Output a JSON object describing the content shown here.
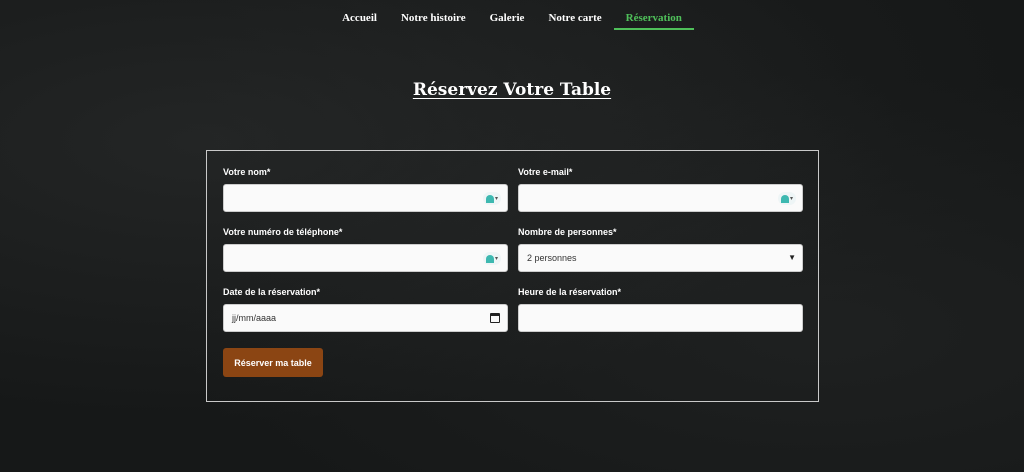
{
  "nav": {
    "items": [
      {
        "label": "Accueil"
      },
      {
        "label": "Notre histoire"
      },
      {
        "label": "Galerie"
      },
      {
        "label": "Notre carte"
      },
      {
        "label": "Réservation"
      }
    ],
    "active_index": 4,
    "active_color": "#4fc05a"
  },
  "page": {
    "title": "Réservez Votre Table"
  },
  "form": {
    "name": {
      "label": "Votre nom*",
      "value": ""
    },
    "email": {
      "label": "Votre e-mail*",
      "value": ""
    },
    "phone": {
      "label": "Votre numéro de téléphone*",
      "value": ""
    },
    "guests": {
      "label": "Nombre de personnes*",
      "value": "2 personnes"
    },
    "date": {
      "label": "Date de la réservation*",
      "placeholder": "jj/mm/aaaa"
    },
    "time": {
      "label": "Heure de la réservation*",
      "value": ""
    },
    "submit_label": "Réserver ma table",
    "submit_color": "#8b4513"
  }
}
